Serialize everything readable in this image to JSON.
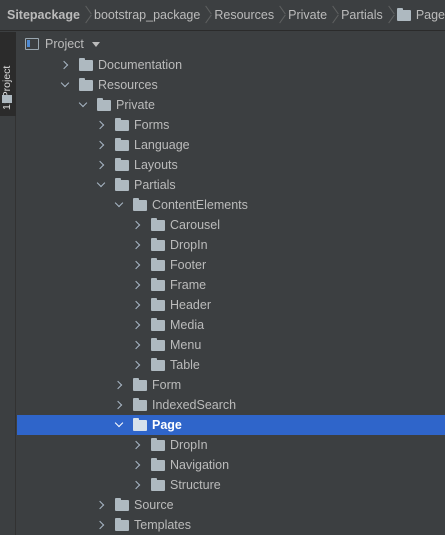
{
  "breadcrumb": {
    "items": [
      "Sitepackage",
      "bootstrap_package",
      "Resources",
      "Private",
      "Partials",
      "Page"
    ]
  },
  "tool_stripe": {
    "project_tab": "1: Project"
  },
  "project_header": {
    "title": "Project"
  },
  "tree": {
    "rows": [
      {
        "label": "Documentation",
        "depth": 0,
        "expanded": false,
        "selected": false
      },
      {
        "label": "Resources",
        "depth": 0,
        "expanded": true,
        "selected": false
      },
      {
        "label": "Private",
        "depth": 1,
        "expanded": true,
        "selected": false
      },
      {
        "label": "Forms",
        "depth": 2,
        "expanded": false,
        "selected": false
      },
      {
        "label": "Language",
        "depth": 2,
        "expanded": false,
        "selected": false
      },
      {
        "label": "Layouts",
        "depth": 2,
        "expanded": false,
        "selected": false
      },
      {
        "label": "Partials",
        "depth": 2,
        "expanded": true,
        "selected": false
      },
      {
        "label": "ContentElements",
        "depth": 3,
        "expanded": true,
        "selected": false
      },
      {
        "label": "Carousel",
        "depth": 4,
        "expanded": false,
        "selected": false
      },
      {
        "label": "DropIn",
        "depth": 4,
        "expanded": false,
        "selected": false
      },
      {
        "label": "Footer",
        "depth": 4,
        "expanded": false,
        "selected": false
      },
      {
        "label": "Frame",
        "depth": 4,
        "expanded": false,
        "selected": false
      },
      {
        "label": "Header",
        "depth": 4,
        "expanded": false,
        "selected": false
      },
      {
        "label": "Media",
        "depth": 4,
        "expanded": false,
        "selected": false
      },
      {
        "label": "Menu",
        "depth": 4,
        "expanded": false,
        "selected": false
      },
      {
        "label": "Table",
        "depth": 4,
        "expanded": false,
        "selected": false
      },
      {
        "label": "Form",
        "depth": 3,
        "expanded": false,
        "selected": false
      },
      {
        "label": "IndexedSearch",
        "depth": 3,
        "expanded": false,
        "selected": false
      },
      {
        "label": "Page",
        "depth": 3,
        "expanded": true,
        "selected": true
      },
      {
        "label": "DropIn",
        "depth": 4,
        "expanded": false,
        "selected": false
      },
      {
        "label": "Navigation",
        "depth": 4,
        "expanded": false,
        "selected": false
      },
      {
        "label": "Structure",
        "depth": 4,
        "expanded": false,
        "selected": false
      },
      {
        "label": "Source",
        "depth": 2,
        "expanded": false,
        "selected": false
      },
      {
        "label": "Templates",
        "depth": 2,
        "expanded": false,
        "selected": false
      }
    ]
  },
  "colors": {
    "background": "#3c3f41",
    "selection": "#2f65ca",
    "folder": "#aeb9c0",
    "text": "#bbbbbb"
  }
}
